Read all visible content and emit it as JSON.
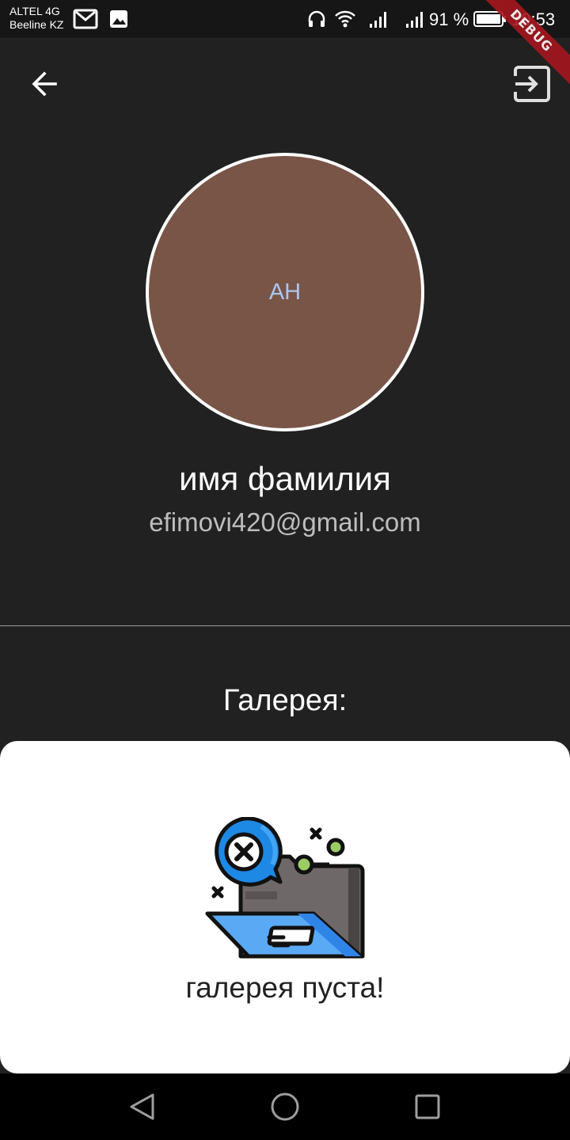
{
  "status_bar": {
    "carrier_line1": "ALTEL 4G",
    "carrier_line2": "Beeline KZ",
    "battery": "91 %",
    "time": "10:53",
    "icons": [
      "gmail-icon",
      "image-icon",
      "headphones-icon",
      "wifi-icon",
      "signal-icon",
      "signal-icon",
      "battery-icon"
    ]
  },
  "debug_banner": "DEBUG",
  "toolbar": {
    "back_icon": "arrow-left-icon",
    "logout_icon": "exit-icon"
  },
  "profile": {
    "initials": "АН",
    "name": "имя фамилия",
    "email": "efimovi420@gmail.com",
    "avatar_color": "#795548"
  },
  "gallery": {
    "title": "Галерея:",
    "empty_text": "галерея пуста!",
    "empty_icon": "empty-folder-icon"
  },
  "nav_bar": {
    "icons": [
      "back-triangle-icon",
      "home-circle-icon",
      "recents-square-icon"
    ]
  }
}
